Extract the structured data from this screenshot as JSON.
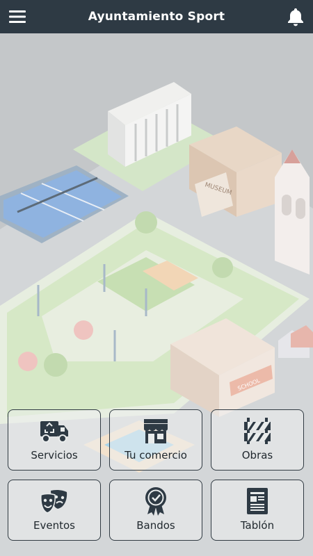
{
  "header": {
    "title": "Ayuntamiento Sport",
    "menu_icon": "hamburger-menu-icon",
    "notification_icon": "bell-icon"
  },
  "background": {
    "labels": {
      "museum": "MUSEUM",
      "school": "SCHOOL"
    }
  },
  "tiles": [
    {
      "label": "Servicios",
      "icon": "recycling-truck-icon"
    },
    {
      "label": "Tu comercio",
      "icon": "storefront-icon"
    },
    {
      "label": "Obras",
      "icon": "road-barrier-icon"
    },
    {
      "label": "Eventos",
      "icon": "theater-masks-icon"
    },
    {
      "label": "Bandos",
      "icon": "award-badge-icon"
    },
    {
      "label": "Tablón",
      "icon": "bulletin-board-icon"
    }
  ],
  "colors": {
    "appbar": "#2e3a44",
    "icon": "#2e3a44",
    "background": "#c4c7c9"
  }
}
